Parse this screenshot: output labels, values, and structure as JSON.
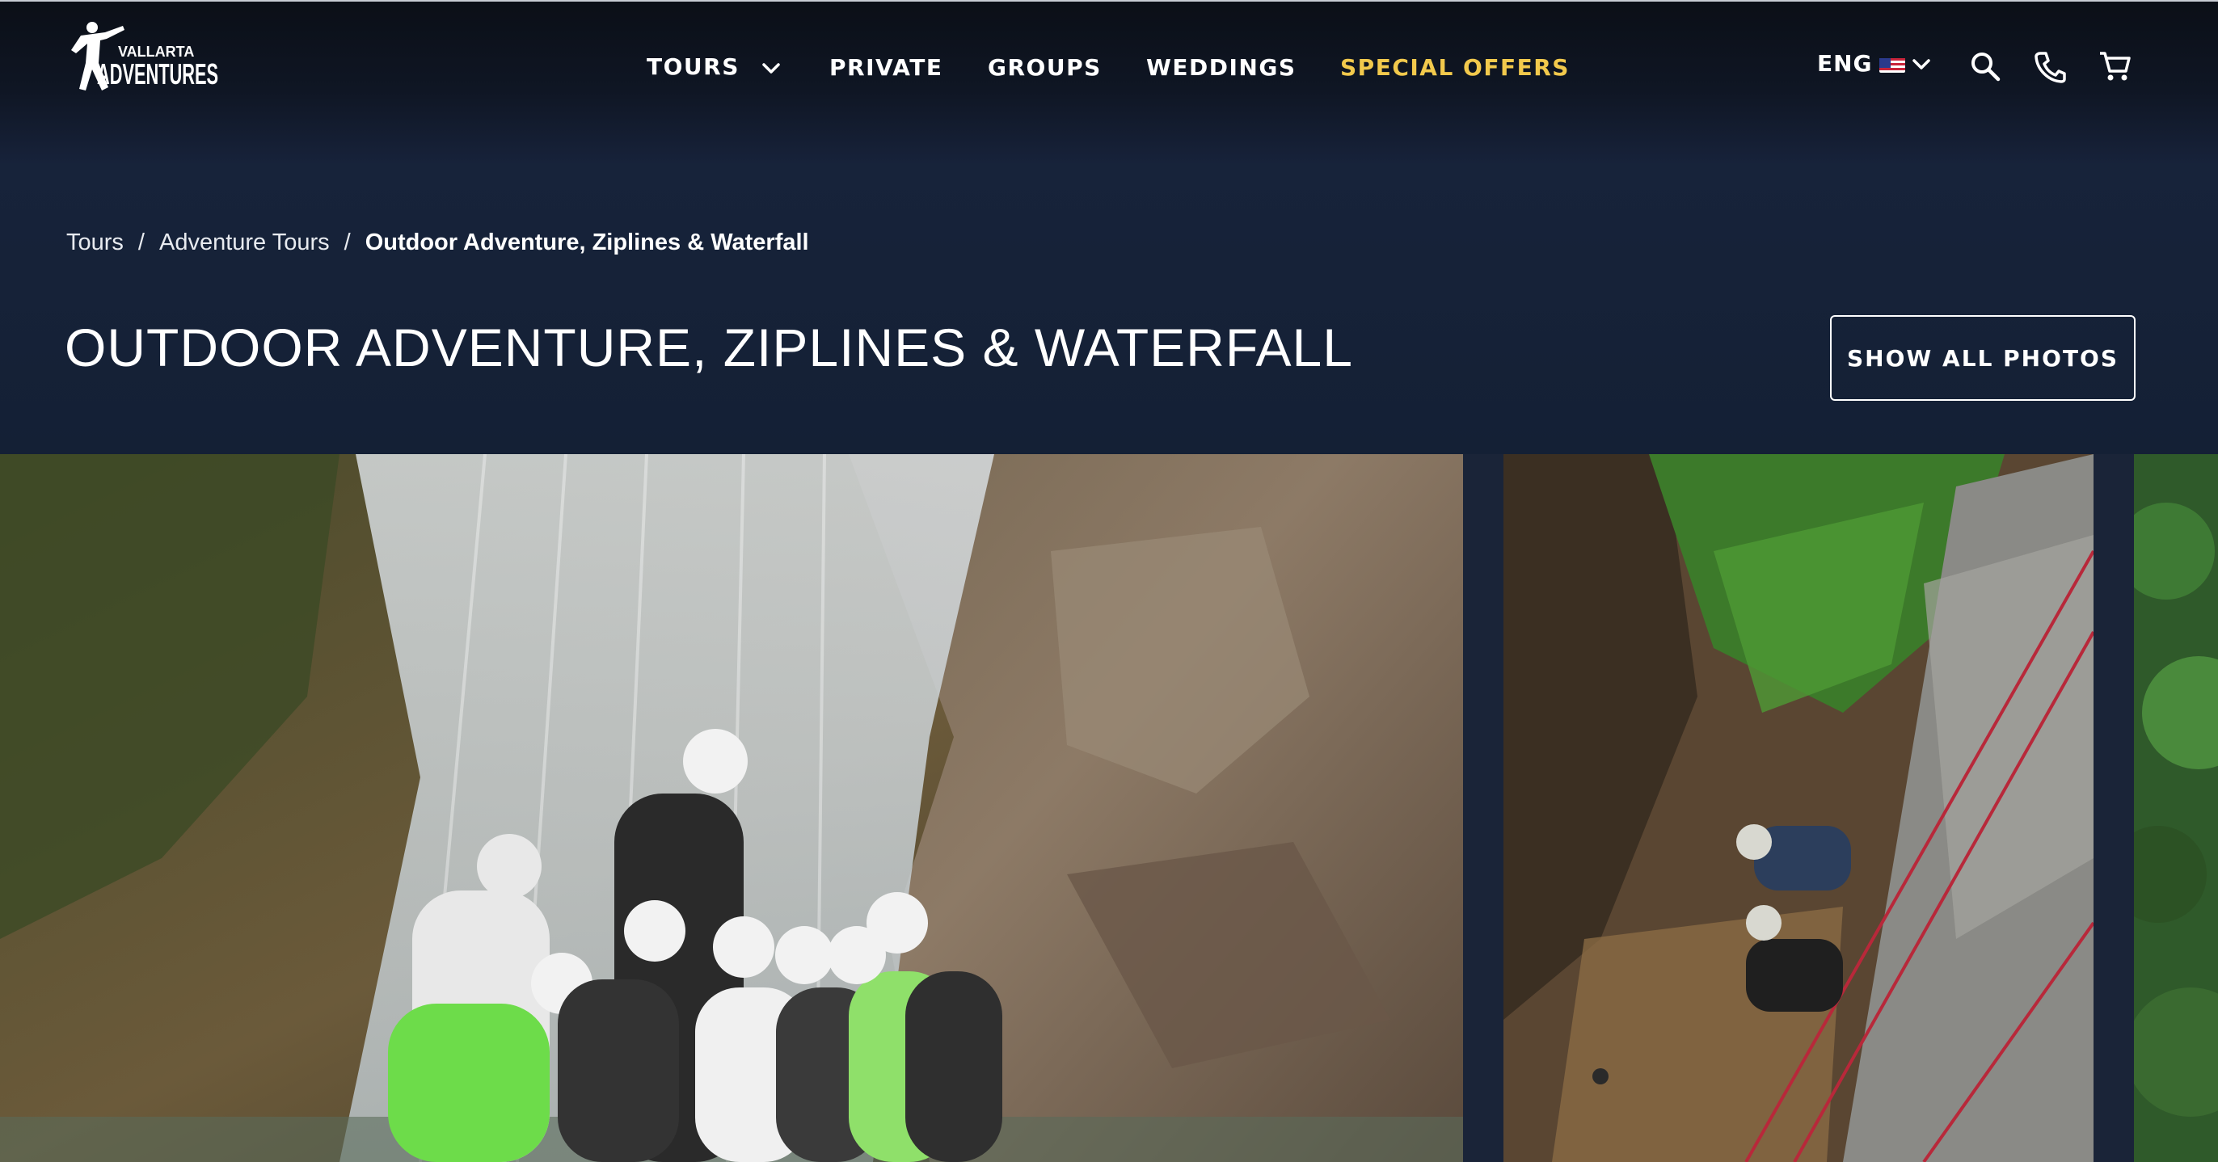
{
  "brand": {
    "logo_line1": "VALLARTA",
    "logo_line2": "ADVENTURES"
  },
  "nav": {
    "items": [
      {
        "label": "TOURS",
        "has_dropdown": true
      },
      {
        "label": "PRIVATE"
      },
      {
        "label": "GROUPS"
      },
      {
        "label": "WEDDINGS"
      },
      {
        "label": "SPECIAL OFFERS",
        "highlight": true
      }
    ],
    "special_color": "#f2c94c"
  },
  "tools": {
    "language": "ENG",
    "flag": "us-flag-icon",
    "icons": [
      "search-icon",
      "phone-icon",
      "cart-icon"
    ]
  },
  "breadcrumb": {
    "items": [
      "Tours",
      "Adventure Tours",
      "Outdoor Adventure, Ziplines & Waterfall"
    ],
    "separator": "/"
  },
  "page": {
    "title": "OUTDOOR ADVENTURE, ZIPLINES & WATERFALL",
    "show_photos_label": "SHOW ALL PHOTOS"
  },
  "gallery": {
    "photos": [
      "group-at-waterfall-photo",
      "rappelling-waterfall-photo",
      "jungle-photo"
    ]
  },
  "colors": {
    "header_bg": "#0b0f17",
    "hero_bg": "#17233a",
    "accent": "#f2c94c"
  }
}
